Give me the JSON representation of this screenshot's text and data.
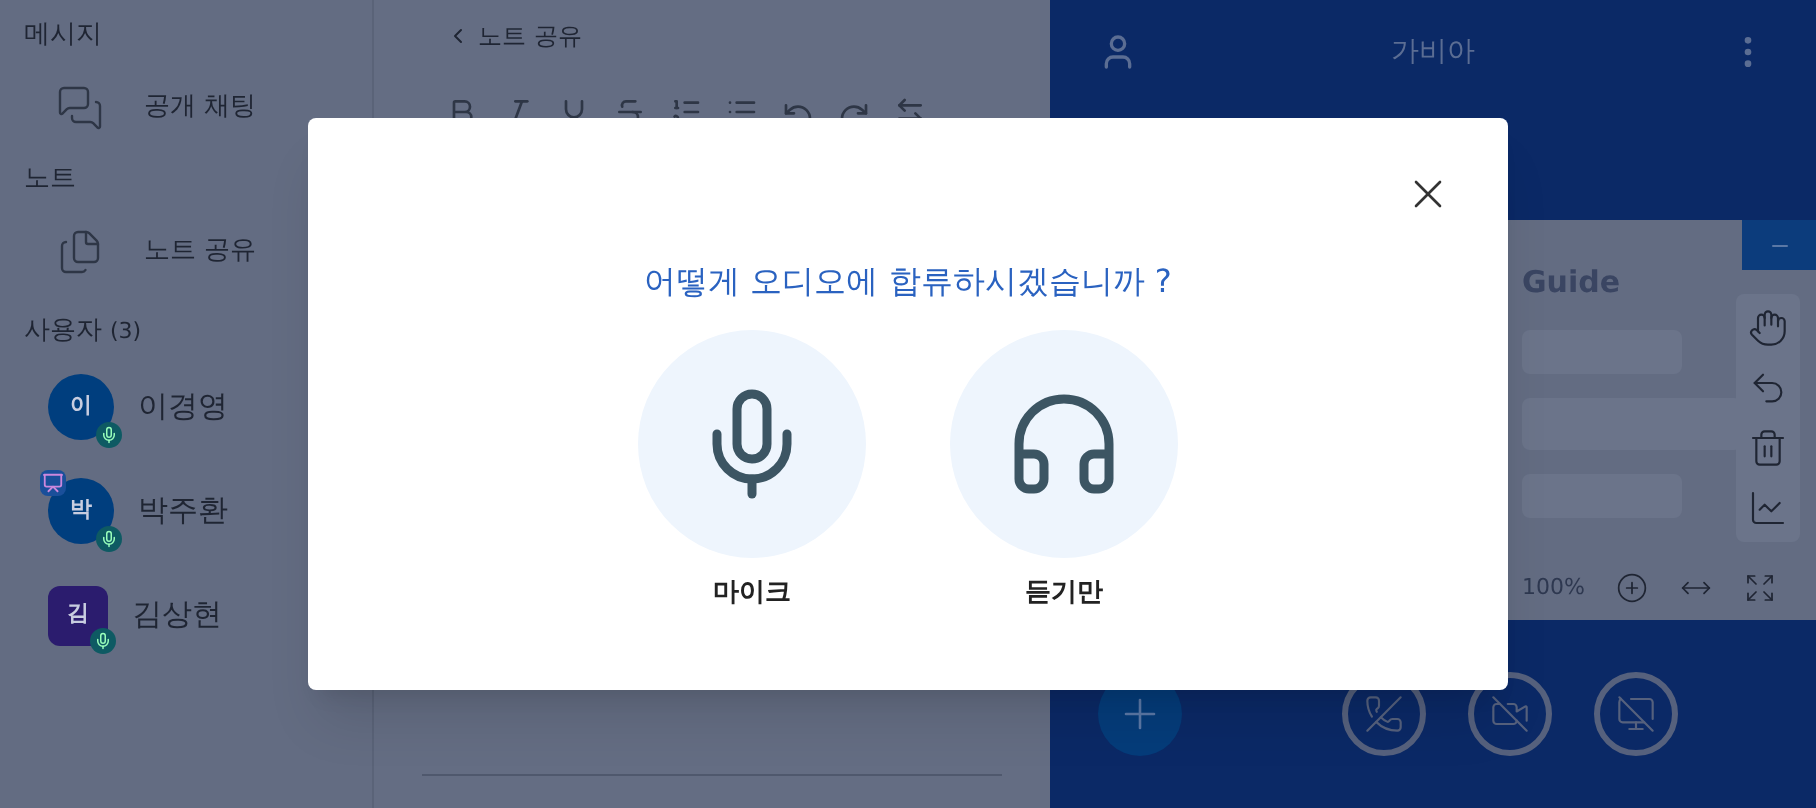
{
  "sidebar": {
    "sections": [
      {
        "title": "메시지",
        "items": [
          {
            "label": "공개 채팅",
            "kind": "chat"
          }
        ]
      },
      {
        "title": "노트",
        "items": [
          {
            "label": "노트 공유",
            "kind": "notes"
          }
        ]
      }
    ],
    "users_title": "사용자",
    "users_count": "(3)",
    "users": [
      {
        "initial": "이",
        "name": "이경영",
        "color": "#003e7e",
        "kind": "circle",
        "presenter": false
      },
      {
        "initial": "박",
        "name": "박주환",
        "color": "#003e7e",
        "kind": "circle",
        "presenter": true
      },
      {
        "initial": "김",
        "name": "김상현",
        "color": "#2b1c6e",
        "kind": "square",
        "presenter": false
      }
    ]
  },
  "notes": {
    "back_label": "노트 공유"
  },
  "header": {
    "title": "가비아"
  },
  "presentation": {
    "heading": "Guide",
    "zoom": "100%"
  },
  "dialog": {
    "question": "어떻게 오디오에 합류하시겠습니까 ?",
    "options": [
      {
        "label": "마이크",
        "kind": "mic"
      },
      {
        "label": "듣기만",
        "kind": "listen"
      }
    ]
  }
}
